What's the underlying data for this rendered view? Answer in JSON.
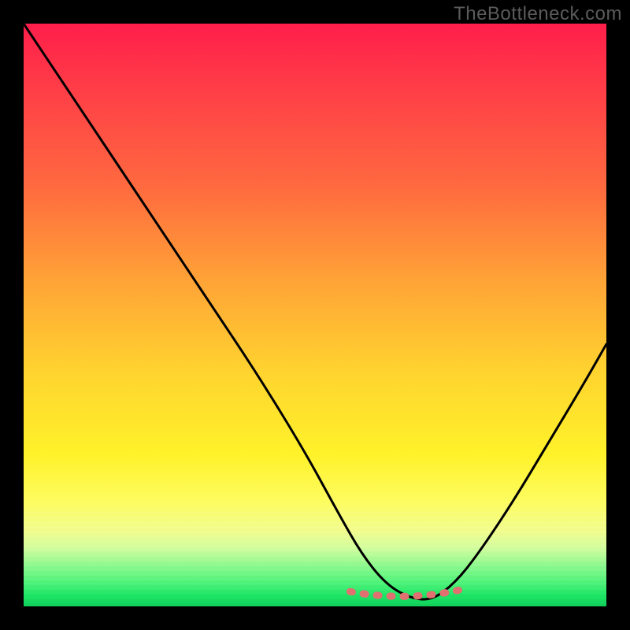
{
  "watermark": "TheBottleneck.com",
  "colors": {
    "gradient_top": "#ff1e4a",
    "gradient_mid1": "#ffa636",
    "gradient_mid2": "#fff22a",
    "gradient_bottom": "#10d05a",
    "curve": "#000000",
    "marker": "#e17070",
    "frame": "#000000"
  },
  "chart_data": {
    "type": "line",
    "title": "",
    "xlabel": "",
    "ylabel": "",
    "xlim": [
      0,
      100
    ],
    "ylim": [
      0,
      100
    ],
    "series": [
      {
        "name": "bottleneck-curve",
        "x": [
          0,
          8,
          16,
          24,
          32,
          40,
          48,
          54,
          58,
          62,
          66,
          70,
          74,
          78,
          84,
          90,
          96,
          100
        ],
        "y": [
          100,
          88,
          76,
          64,
          52,
          40,
          27,
          16,
          9,
          4,
          1.5,
          1,
          4,
          9,
          18,
          28,
          38,
          45
        ]
      }
    ],
    "annotations": [
      {
        "name": "optimal-range-marker",
        "x_start": 56,
        "x_end": 76,
        "y": 2
      }
    ]
  }
}
